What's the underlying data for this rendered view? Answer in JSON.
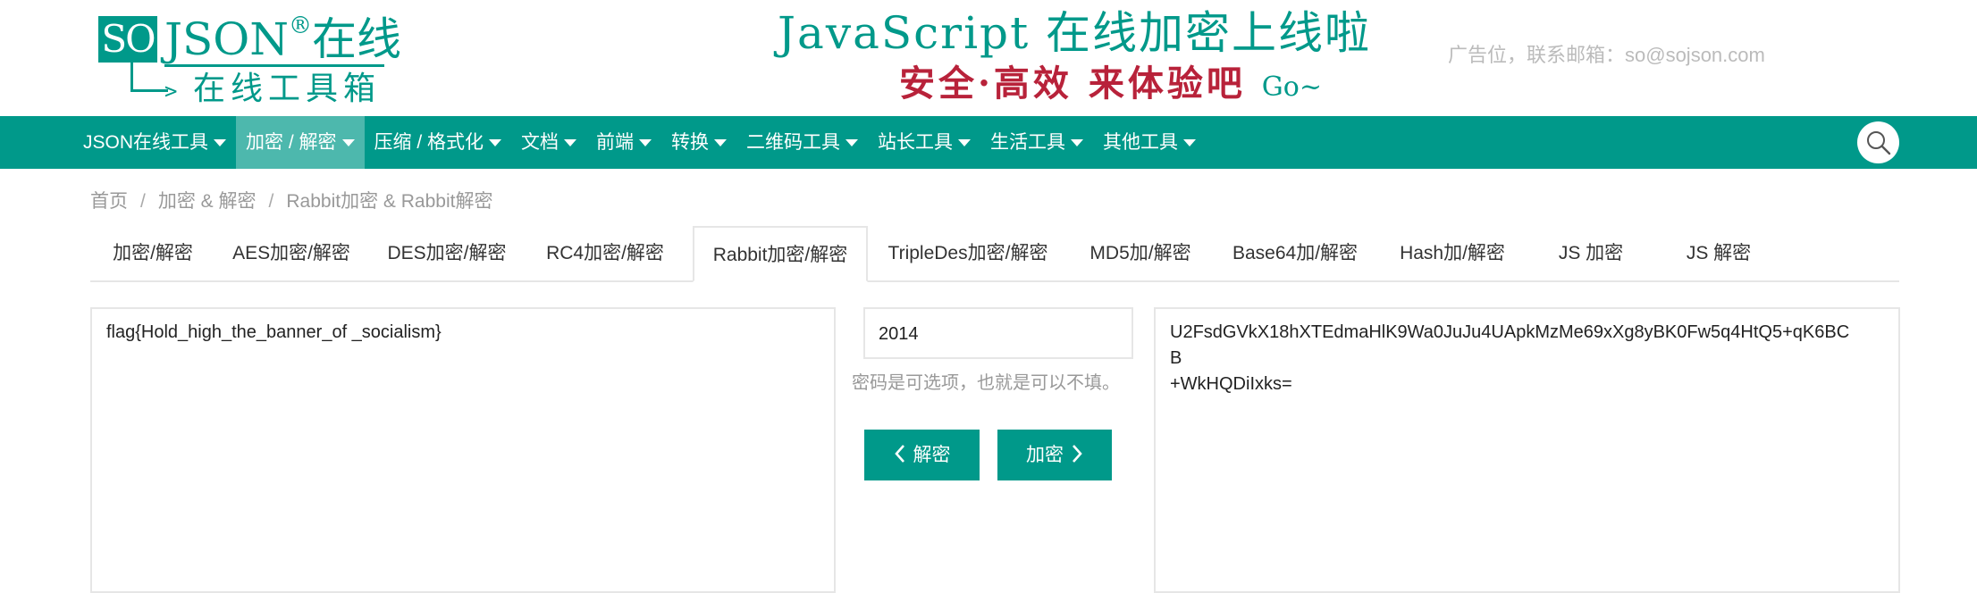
{
  "logo": {
    "box_text": "SO",
    "json_text": "JSON",
    "reg_mark": "®",
    "online_text": "在线",
    "subtitle": "在线工具箱"
  },
  "promo": {
    "title": "JavaScript 在线加密上线啦",
    "subtitle": "安全·高效 来体验吧",
    "go": "Go~"
  },
  "ad": {
    "text": "广告位，联系邮箱：so@sojson.com"
  },
  "nav": {
    "items": [
      {
        "label": "JSON在线工具"
      },
      {
        "label": "加密 / 解密"
      },
      {
        "label": "压缩 / 格式化"
      },
      {
        "label": "文档"
      },
      {
        "label": "前端"
      },
      {
        "label": "转换"
      },
      {
        "label": "二维码工具"
      },
      {
        "label": "站长工具"
      },
      {
        "label": "生活工具"
      },
      {
        "label": "其他工具"
      }
    ],
    "active_index": 1
  },
  "breadcrumb": {
    "items": [
      "首页",
      "加密 & 解密",
      "Rabbit加密 & Rabbit解密"
    ],
    "separator": "/"
  },
  "tabs": [
    {
      "label": "加密/解密"
    },
    {
      "label": "AES加密/解密"
    },
    {
      "label": "DES加密/解密"
    },
    {
      "label": "RC4加密/解密"
    },
    {
      "label": "Rabbit加密/解密"
    },
    {
      "label": "TripleDes加密/解密"
    },
    {
      "label": "MD5加/解密"
    },
    {
      "label": "Base64加/解密"
    },
    {
      "label": "Hash加/解密"
    },
    {
      "label": "JS 加密"
    },
    {
      "label": "JS 解密"
    }
  ],
  "active_tab": 4,
  "input": {
    "plaintext": "flag{Hold_high_the_banner_of _socialism}"
  },
  "password": {
    "value": "2014",
    "hint": "密码是可选项，也就是可以不填。"
  },
  "buttons": {
    "decrypt": "解密",
    "encrypt": "加密"
  },
  "output": {
    "line1": "U2FsdGVkX18hXTEdmaHlK9Wa0JuJu4UApkMzMe69xXg8yBK0Fw5q4HtQ5+qK6BC",
    "line2": "B",
    "line3": "+WkHQDiIxks="
  },
  "colors": {
    "brand": "#00998a",
    "promo_red": "#b8223a",
    "nav_active": "#4db8ad"
  }
}
